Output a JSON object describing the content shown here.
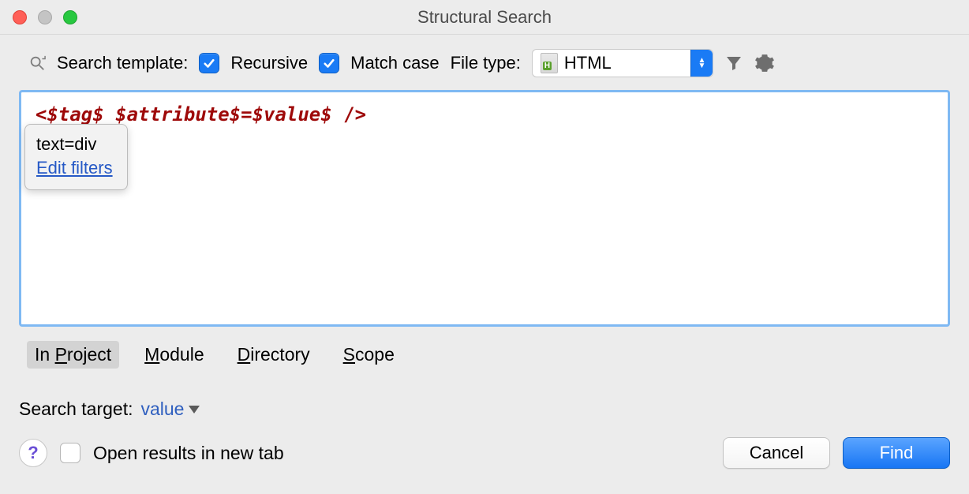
{
  "window": {
    "title": "Structural Search"
  },
  "toolbar": {
    "search_template_label": "Search template:",
    "recursive_label": "Recursive",
    "recursive_checked": true,
    "match_case_label": "Match case",
    "match_case_checked": true,
    "file_type_label": "File type:",
    "file_type_value": "HTML",
    "icons": {
      "search": "search-icon",
      "filter": "filter-icon",
      "settings": "gear-icon"
    }
  },
  "editor": {
    "template": {
      "open": "<",
      "var_tag": "$tag$",
      "space": " ",
      "var_attribute": "$attribute$",
      "eq": "=",
      "var_value": "$value$",
      "close": " />"
    },
    "tooltip": {
      "line1": "text=div",
      "edit_filters_label": "Edit filters"
    }
  },
  "scope_tabs": {
    "items": [
      {
        "label_pre": "In ",
        "ul": "P",
        "label_post": "roject",
        "active": true
      },
      {
        "label_pre": "",
        "ul": "M",
        "label_post": "odule",
        "active": false
      },
      {
        "label_pre": "",
        "ul": "D",
        "label_post": "irectory",
        "active": false
      },
      {
        "label_pre": "",
        "ul": "S",
        "label_post": "cope",
        "active": false
      }
    ]
  },
  "search_target": {
    "label": "Search target:",
    "value": "value"
  },
  "footer": {
    "open_results_label": "Open results in new tab",
    "open_results_checked": false,
    "help_label": "?",
    "cancel_label": "Cancel",
    "find_label": "Find"
  },
  "colors": {
    "accent": "#1a7bf5",
    "window_bg": "#ececec",
    "editor_border": "#7fb9f3",
    "template_red": "#9e0909",
    "link_blue": "#2659c6"
  }
}
